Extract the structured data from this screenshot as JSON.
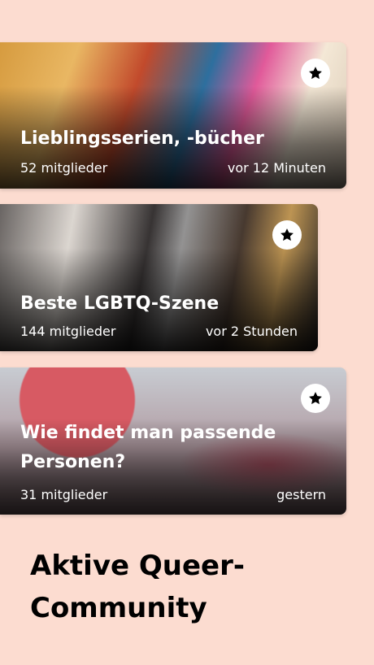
{
  "groups": [
    {
      "title": "Lieblingsserien, -bücher",
      "members": "52 mitglieder",
      "last_activity": "vor 12 Minuten",
      "favorite_icon": "star-icon"
    },
    {
      "title": "Beste LGBTQ-Szene",
      "members": "144 mitglieder",
      "last_activity": "vor 2 Stunden",
      "favorite_icon": "star-icon"
    },
    {
      "title": "Wie findet man passende Personen?",
      "members": "31 mitglieder",
      "last_activity": "gestern",
      "favorite_icon": "star-icon"
    }
  ],
  "tagline": {
    "line1": "Aktive Queer-",
    "line2": "Community"
  },
  "colors": {
    "background": "#fcdcd0",
    "text_on_card": "#ffffff",
    "star_button_bg": "#ffffff",
    "star_icon": "#000000"
  }
}
